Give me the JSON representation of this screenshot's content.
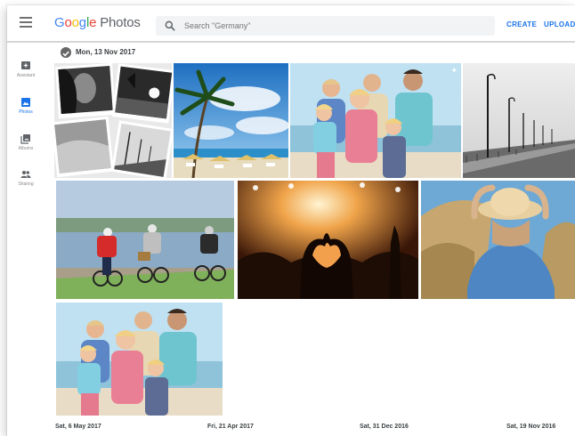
{
  "header": {
    "logo": {
      "g": "G",
      "o1": "o",
      "o2": "o",
      "g2": "g",
      "l": "l",
      "e": "e",
      "product": "Photos"
    },
    "search_placeholder": "Search \"Germany\"",
    "create_label": "CREATE",
    "upload_label": "UPLOAD"
  },
  "sidebar": {
    "items": [
      {
        "label": "Assistant",
        "active": false
      },
      {
        "label": "Photos",
        "active": true
      },
      {
        "label": "Albums",
        "active": false
      },
      {
        "label": "Sharing",
        "active": false
      }
    ]
  },
  "sections": {
    "current_date": "Mon, 13 Nov 2017",
    "footer_dates": [
      "Sat, 6 May 2017",
      "Fri, 21 Apr 2017",
      "Sat, 31 Dec 2016",
      "Sat, 19 Nov 2016"
    ]
  },
  "photos": [
    {
      "name": "bw-collage"
    },
    {
      "name": "palm-beach"
    },
    {
      "name": "family-beach"
    },
    {
      "name": "pier-bw"
    },
    {
      "name": "cyclists-river"
    },
    {
      "name": "concert-heart-hands"
    },
    {
      "name": "woman-straw-hat"
    },
    {
      "name": "family-beach-2"
    }
  ],
  "colors": {
    "accent": "#1a73e8",
    "sidebar_icon": "#5f6368"
  }
}
